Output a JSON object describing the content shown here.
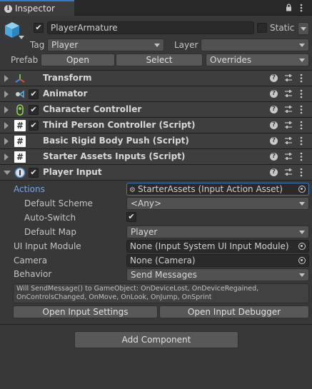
{
  "tab": {
    "title": "Inspector"
  },
  "header": {
    "object_name": "PlayerArmature",
    "static_label": "Static",
    "tag_label": "Tag",
    "tag_value": "Player",
    "layer_label": "Layer",
    "layer_value": "",
    "prefab_label": "Prefab",
    "open_label": "Open",
    "select_label": "Select",
    "overrides_label": "Overrides"
  },
  "components": [
    {
      "name": "Transform",
      "icon": "transform-axes-icon",
      "has_checkbox": false
    },
    {
      "name": "Animator",
      "icon": "animator-icon",
      "has_checkbox": true
    },
    {
      "name": "Character Controller",
      "icon": "character-controller-icon",
      "has_checkbox": true
    },
    {
      "name": "Third Person Controller (Script)",
      "icon": "script-hash-icon",
      "has_checkbox": true
    },
    {
      "name": "Basic Rigid Body Push (Script)",
      "icon": "script-hash-icon",
      "has_checkbox": false
    },
    {
      "name": "Starter Assets Inputs (Script)",
      "icon": "script-hash-icon",
      "has_checkbox": false
    },
    {
      "name": "Player Input",
      "icon": "player-input-icon",
      "has_checkbox": true
    }
  ],
  "player_input": {
    "actions_label": "Actions",
    "actions_value": "StarterAssets (Input Action Asset)",
    "default_scheme_label": "Default Scheme",
    "default_scheme_value": "<Any>",
    "auto_switch_label": "Auto-Switch",
    "default_map_label": "Default Map",
    "default_map_value": "Player",
    "ui_input_module_label": "UI Input Module",
    "ui_input_module_value": "None (Input System UI Input Module)",
    "camera_label": "Camera",
    "camera_value": "None (Camera)",
    "behavior_label": "Behavior",
    "behavior_value": "Send Messages",
    "help_text": "Will SendMessage() to GameObject: OnDeviceLost, OnDeviceRegained, OnControlsChanged, OnMove, OnLook, OnJump, OnSprint",
    "open_settings_label": "Open Input Settings",
    "open_debugger_label": "Open Input Debugger"
  },
  "add_component_label": "Add Component",
  "colors": {
    "accent": "#3a79bb",
    "actions_label": "#7aa7e0",
    "background": "#383838",
    "component_header": "#3e3e3e"
  }
}
